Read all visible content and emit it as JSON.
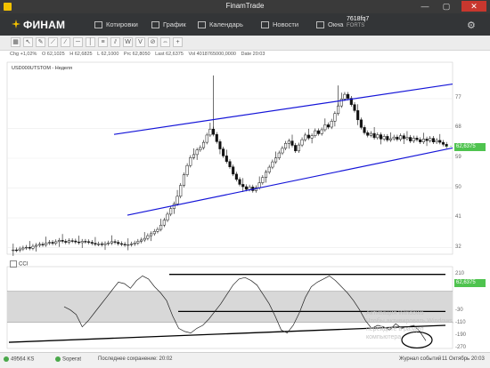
{
  "window": {
    "title": "FinamTrade"
  },
  "toolbar": {
    "brand": "ФИНАМ",
    "items": [
      {
        "key": "quotes",
        "label": "Котировки",
        "icon": "quotes-icon"
      },
      {
        "key": "chart",
        "label": "График",
        "icon": "chart-icon"
      },
      {
        "key": "calendar",
        "label": "Календарь",
        "icon": "calendar-icon"
      },
      {
        "key": "news",
        "label": "Новости",
        "icon": "news-icon"
      },
      {
        "key": "windows",
        "label": "Окна",
        "icon": "windows-icon"
      }
    ],
    "account": "7618fq7",
    "account_sub": "FORTS"
  },
  "ohlc": {
    "change": "Chg +1,02%",
    "open": "O 62,1025",
    "high": "H 62,6825",
    "low": "L 62,1000",
    "prc": "Prc 62,8050",
    "last": "Last 62,6375",
    "vol": "Vol 4018765000,0000",
    "date": "Date 20:03"
  },
  "chart": {
    "symbol": "USD000UTSTOM - Неделя",
    "last_price_badge": "62,6375",
    "price_ticks": [
      "77",
      "68",
      "59",
      "50",
      "41",
      "32"
    ],
    "indicator_name": "CCI",
    "indicator_badge": "62,6375",
    "indicator_ticks": [
      "210",
      "130",
      "-30",
      "-110",
      "-190",
      "-270"
    ]
  },
  "chart_data": {
    "type": "candlestick",
    "ylim": [
      30,
      88
    ],
    "price_ticks": [
      77,
      68,
      59,
      50,
      41,
      32
    ],
    "close": [
      31.3,
      31.2,
      31.6,
      31.9,
      32.1,
      31.8,
      32.4,
      32.7,
      33.0,
      32.8,
      33.4,
      33.6,
      33.3,
      33.8,
      34.2,
      33.9,
      33.6,
      34.1,
      34.0,
      33.7,
      33.5,
      33.9,
      33.8,
      33.6,
      33.3,
      33.0,
      33.1,
      32.9,
      33.2,
      33.4,
      33.8,
      33.6,
      33.2,
      33.0,
      32.8,
      32.9,
      33.1,
      33.4,
      33.9,
      34.3,
      34.8,
      35.6,
      36.2,
      36.9,
      37.5,
      38.8,
      40.3,
      42.1,
      43.8,
      45.2,
      47.5,
      50.8,
      54.0,
      56.8,
      59.2,
      60.1,
      61.5,
      62.2,
      63.8,
      66.0,
      67.8,
      66.2,
      64.0,
      61.8,
      59.7,
      58.0,
      56.4,
      54.2,
      52.6,
      51.1,
      50.4,
      49.6,
      50.3,
      49.2,
      50.1,
      51.6,
      53.2,
      54.8,
      56.3,
      57.9,
      59.1,
      60.6,
      62.0,
      63.5,
      64.2,
      62.9,
      61.2,
      63.0,
      64.6,
      66.0,
      65.1,
      65.8,
      67.3,
      66.4,
      67.6,
      69.1,
      68.4,
      70.2,
      72.5,
      74.8,
      76.9,
      78.3,
      77.1,
      75.2,
      73.4,
      70.6,
      68.3,
      66.7,
      65.9,
      66.5,
      65.2,
      66.1,
      64.8,
      65.6,
      64.5,
      64.9,
      65.4,
      64.7,
      65.8,
      64.9,
      65.3,
      64.2,
      65.1,
      64.6,
      63.9,
      64.8,
      64.3,
      65.0,
      63.9,
      64.4,
      63.8,
      63.2,
      62.6
    ],
    "channel_upper": [
      [
        70,
        66.2
      ],
      [
        275,
        81.4
      ]
    ],
    "channel_lower": [
      [
        70,
        41.8
      ],
      [
        275,
        62.1
      ]
    ],
    "cci": {
      "ylim": [
        -270,
        260
      ],
      "ticks": [
        210,
        130,
        -30,
        -110,
        -190,
        -270
      ],
      "lines": [
        210,
        -30,
        -190
      ],
      "overbought": 100,
      "oversold": -100,
      "values": [
        0,
        -20,
        -50,
        -130,
        -90,
        -40,
        10,
        60,
        110,
        160,
        150,
        120,
        170,
        200,
        180,
        130,
        90,
        40,
        -60,
        -140,
        -160,
        -170,
        -140,
        -120,
        -80,
        -30,
        20,
        80,
        140,
        180,
        190,
        170,
        140,
        80,
        20,
        -60,
        -150,
        -170,
        -120,
        -40,
        60,
        130,
        160,
        180,
        200,
        170,
        130,
        90,
        40,
        -20,
        -90,
        -140,
        -120,
        -130,
        -150,
        -110,
        -140,
        -130,
        -120,
        -160,
        -220
      ]
    }
  },
  "watermark": {
    "line1": "Активация Windows",
    "line2": "Чтобы активировать Windows,",
    "line3": "перейдите в раздел",
    "line4": "компьютера"
  },
  "status": {
    "code": "49564 KS",
    "server": "Soperat",
    "saved": "Последнее сохранение: 20:02",
    "log": "Журнал событий",
    "date": "11 Октябрь 20:03"
  },
  "colors": {
    "channel": "#1515d8",
    "badge": "#4fc34f",
    "titlebar": "#3a3a3a",
    "toolbar": "#333537"
  }
}
